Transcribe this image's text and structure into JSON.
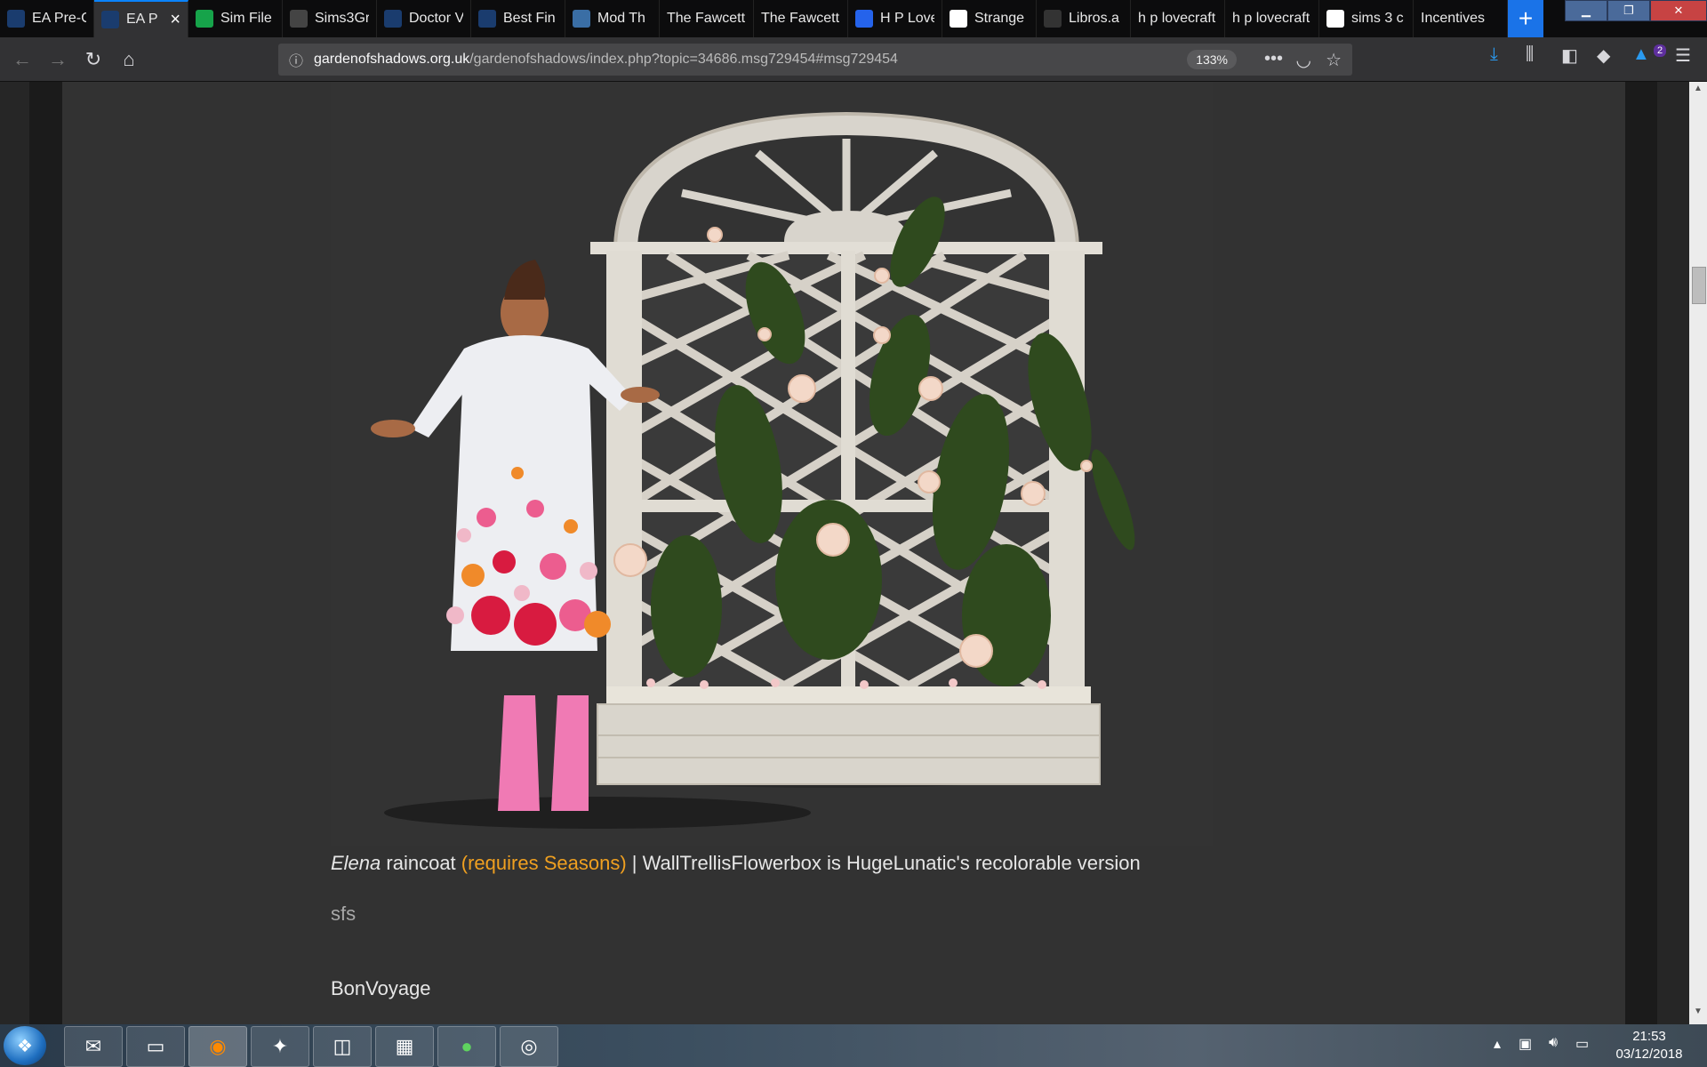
{
  "browser": {
    "tabs": [
      {
        "title": "EA Pre-C",
        "icon": "ea-favicon",
        "color": "#1a3c6e"
      },
      {
        "title": "EA P",
        "icon": "ea-favicon",
        "color": "#1a3c6e",
        "active": true
      },
      {
        "title": "Sim File",
        "icon": "plumbob-favicon",
        "color": "#16a34a"
      },
      {
        "title": "Sims3Gr",
        "icon": "sims3gr-favicon",
        "color": "#444444"
      },
      {
        "title": "Doctor V",
        "icon": "doctor-favicon",
        "color": "#1a3c6e"
      },
      {
        "title": "Best Fin",
        "icon": "bestfin-favicon",
        "color": "#1a3c6e"
      },
      {
        "title": "Mod Th",
        "icon": "modthesims-favicon",
        "color": "#3a6ea5"
      },
      {
        "title": "The Fawcett",
        "icon": "",
        "color": ""
      },
      {
        "title": "The Fawcett",
        "icon": "",
        "color": ""
      },
      {
        "title": "H P Love",
        "icon": "hplove-favicon",
        "color": "#2563eb"
      },
      {
        "title": "Strange",
        "icon": "sh-favicon",
        "color": "#ffffff"
      },
      {
        "title": "Libros.a",
        "icon": "libros-favicon",
        "color": "#333333"
      },
      {
        "title": "h p lovecraft",
        "icon": "",
        "color": ""
      },
      {
        "title": "h p lovecraft",
        "icon": "",
        "color": ""
      },
      {
        "title": "sims 3 c",
        "icon": "google-favicon",
        "color": "#ffffff"
      },
      {
        "title": "Incentives",
        "icon": "",
        "color": ""
      }
    ],
    "url_domain": "gardenofshadows.org.uk",
    "url_path": "/gardenofshadows/index.php?topic=34686.msg729454#msg729454",
    "zoom": "133%",
    "notification_count": "2"
  },
  "post": {
    "caption_italic": "Elena",
    "caption_part1": " raincoat ",
    "caption_link": "(requires Seasons)",
    "caption_part2": " | WallTrellisFlowerbox is HugeLunatic's recolorable version",
    "sfs_link": "sfs",
    "next_heading": "BonVoyage"
  },
  "taskbar": {
    "time": "21:53",
    "date": "03/12/2018"
  },
  "colors": {
    "accent_link": "#f0a020",
    "tab_active_border": "#0a84ff"
  }
}
